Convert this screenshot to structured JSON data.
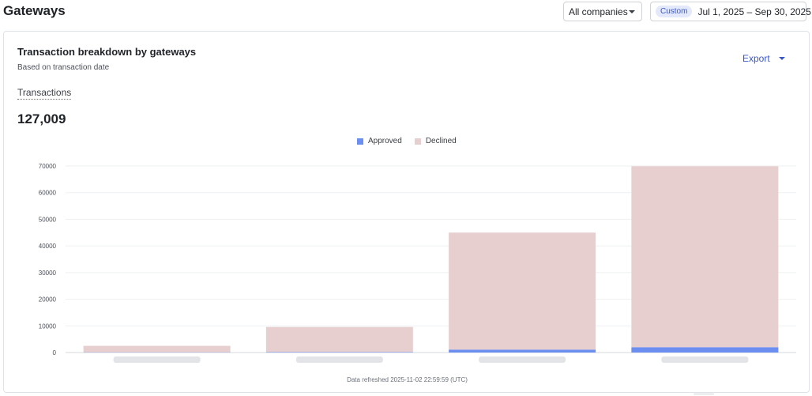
{
  "header": {
    "title": "Gateways",
    "company_select": "All companies",
    "date_badge": "Custom",
    "date_range": "Jul 1, 2025 – Sep 30, 2025"
  },
  "card": {
    "title": "Transaction breakdown by gateways",
    "subtitle": "Based on transaction date",
    "export_label": "Export",
    "metric_label": "Transactions",
    "metric_value": "127,009",
    "footer": "Data refreshed 2025-11-02 22:59:59 (UTC)"
  },
  "colors": {
    "approved": "#6b8ef0",
    "declined": "#e8cfcf",
    "accent": "#3b57c4"
  },
  "chart_data": {
    "type": "bar",
    "stacked": true,
    "categories": [
      "",
      "",
      "",
      ""
    ],
    "series": [
      {
        "name": "Approved",
        "values": [
          100,
          200,
          1100,
          2000
        ]
      },
      {
        "name": "Declined",
        "values": [
          2400,
          9400,
          43900,
          67900
        ]
      }
    ],
    "yticks": [
      "70000",
      "60000",
      "50000",
      "40000",
      "30000",
      "20000",
      "10000",
      "0"
    ],
    "ylim": [
      0,
      70000
    ],
    "grid": true,
    "legend_position": "top-center",
    "x_tick_labels_blurred": true
  }
}
